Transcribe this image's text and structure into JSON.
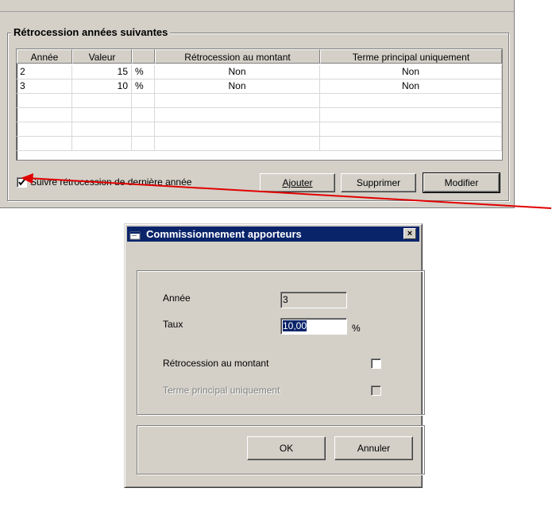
{
  "group_title": "Rétrocession années suivantes",
  "table": {
    "headers": [
      "Année",
      "Valeur",
      "",
      "Rétrocession au montant",
      "Terme principal uniquement"
    ],
    "rows": [
      [
        "2",
        "15",
        "%",
        "Non",
        "Non"
      ],
      [
        "3",
        "10",
        "%",
        "Non",
        "Non"
      ]
    ]
  },
  "checkbox_label": "Suivre rétrocession de dernière année",
  "checkbox_checked": true,
  "buttons": {
    "add": "Ajouter",
    "delete": "Supprimer",
    "modify": "Modifier"
  },
  "dialog": {
    "title": "Commissionnement apporteurs",
    "year_label": "Année",
    "year_value": "3",
    "rate_label": "Taux",
    "rate_value": "10,00",
    "rate_unit": "%",
    "retro_amount_label": "Rétrocession au montant",
    "main_term_label": "Terme principal uniquement",
    "ok_label": "OK",
    "cancel_label": "Annuler",
    "close_glyph": "×"
  },
  "colors": {
    "face": "#d4d0c8",
    "titlebar": "#0a246a",
    "arrow": "#e00000"
  }
}
